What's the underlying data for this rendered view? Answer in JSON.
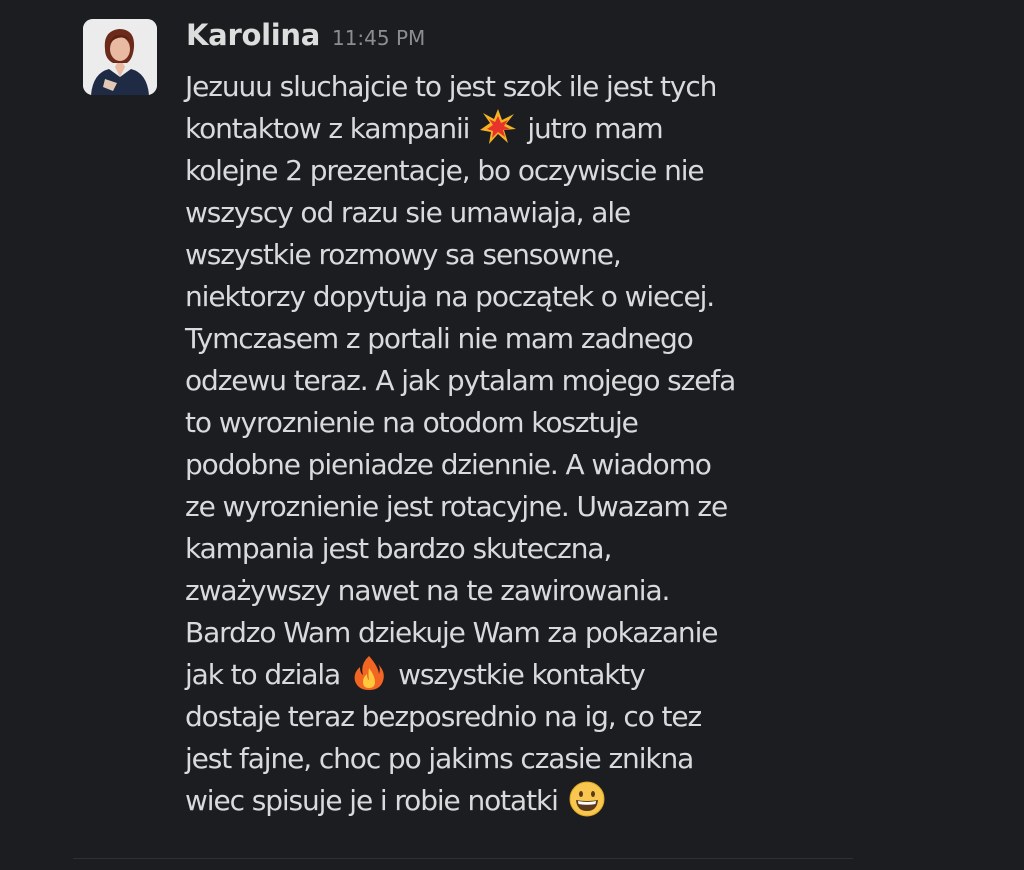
{
  "message": {
    "author": "Karolina",
    "time": "11:45 PM",
    "lines": [
      "Jezuuu sluchajcie to jest szok ile jest tych",
      [
        "kontaktow z kampanii",
        "jutro mam"
      ],
      "kolejne 2 prezentacje, bo oczywiscie nie",
      "wszyscy od razu sie umawiaja, ale",
      "wszystkie rozmowy sa sensowne,",
      "niektorzy dopytuja na początek o wiecej.",
      "Tymczasem z portali nie mam zadnego",
      "odzewu teraz. A jak pytalam mojego szefa",
      "to wyroznienie na otodom kosztuje",
      "podobne pieniadze dziennie. A wiadomo",
      "ze wyroznienie jest rotacyjne. Uwazam ze",
      "kampania jest bardzo skuteczna,",
      "zważywszy nawet na te zawirowania.",
      "Bardzo Wam dziekuje Wam za pokazanie",
      [
        "jak to dziala",
        "wszystkie kontakty"
      ],
      "dostaje teraz bezposrednio na ig, co tez",
      "jest fajne, choc po jakims czasie znikna",
      [
        "wiec spisuje je i robie notatki",
        ""
      ]
    ],
    "emojis": [
      "collision-emoji",
      "fire-emoji",
      "grinning-face-emoji"
    ]
  }
}
